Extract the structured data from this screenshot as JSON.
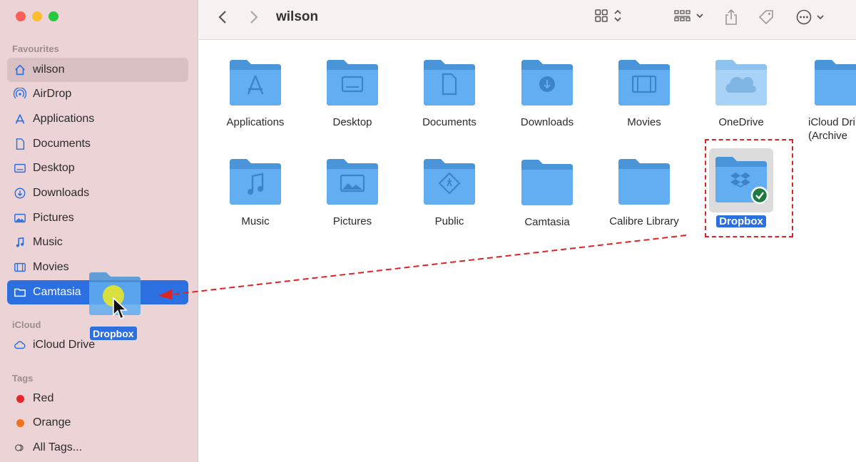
{
  "window": {
    "title": "wilson"
  },
  "sidebar": {
    "sections": {
      "favourites": "Favourites",
      "icloud": "iCloud",
      "tags": "Tags"
    },
    "favourites": [
      {
        "label": "wilson",
        "icon": "home-icon"
      },
      {
        "label": "AirDrop",
        "icon": "airdrop-icon"
      },
      {
        "label": "Applications",
        "icon": "applications-icon"
      },
      {
        "label": "Documents",
        "icon": "document-icon"
      },
      {
        "label": "Desktop",
        "icon": "desktop-icon"
      },
      {
        "label": "Downloads",
        "icon": "download-icon"
      },
      {
        "label": "Pictures",
        "icon": "pictures-icon"
      },
      {
        "label": "Music",
        "icon": "music-icon"
      },
      {
        "label": "Movies",
        "icon": "movies-icon"
      },
      {
        "label": "Camtasia",
        "icon": "folder-icon"
      }
    ],
    "icloud": [
      {
        "label": "iCloud Drive",
        "icon": "cloud-icon"
      }
    ],
    "tags": [
      {
        "label": "Red",
        "color": "#e8252a"
      },
      {
        "label": "Orange",
        "color": "#f2711c"
      },
      {
        "label": "All Tags...",
        "icon": "tags-icon"
      }
    ]
  },
  "drag": {
    "label": "Dropbox"
  },
  "files": [
    {
      "label": "Applications",
      "icon": "app-store-icon"
    },
    {
      "label": "Desktop",
      "icon": "desktop-icon"
    },
    {
      "label": "Documents",
      "icon": "document-icon"
    },
    {
      "label": "Downloads",
      "icon": "download-icon"
    },
    {
      "label": "Movies",
      "icon": "film-icon"
    },
    {
      "label": "OneDrive",
      "icon": "cloud-icon"
    },
    {
      "label": "iCloud Dri\n(Archive",
      "icon": "folder-icon"
    },
    {
      "label": "Music",
      "icon": "music-icon"
    },
    {
      "label": "Pictures",
      "icon": "pictures-icon"
    },
    {
      "label": "Public",
      "icon": "public-icon"
    },
    {
      "label": "Camtasia",
      "icon": "folder-icon"
    },
    {
      "label": "Calibre Library",
      "icon": "folder-icon"
    },
    {
      "label": "Dropbox",
      "icon": "dropbox-icon",
      "selected": true
    }
  ],
  "colors": {
    "accent": "#2b6fe0",
    "folder": "#5aa8ea",
    "annotation": "#e02222",
    "synced": "#1e7a3c"
  }
}
